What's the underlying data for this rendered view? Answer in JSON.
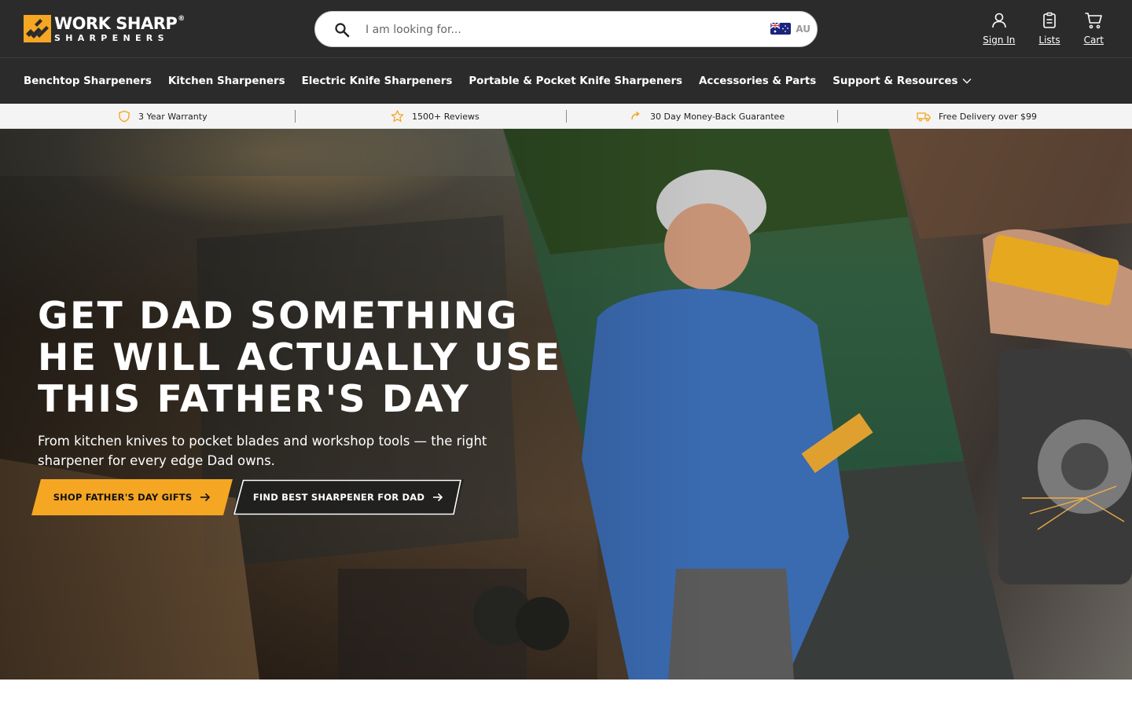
{
  "brand": {
    "name_line1": "WORK SHARP",
    "registered_mark": "®",
    "name_line2": "SHARPENERS",
    "accent_color": "#f5a623",
    "header_bg": "#2b2b2b"
  },
  "search": {
    "placeholder": "I am looking for...",
    "value": "",
    "region_code": "AU",
    "icon": "search-icon",
    "flag_icon": "australia-flag-icon"
  },
  "header_actions": [
    {
      "label": "Sign In",
      "icon": "user-icon"
    },
    {
      "label": "Lists",
      "icon": "clipboard-icon"
    },
    {
      "label": "Cart",
      "icon": "cart-icon"
    }
  ],
  "nav": {
    "items": [
      {
        "label": "Benchtop Sharpeners"
      },
      {
        "label": "Kitchen Sharpeners"
      },
      {
        "label": "Electric Knife Sharpeners"
      },
      {
        "label": "Portable & Pocket Knife Sharpeners"
      },
      {
        "label": "Accessories & Parts"
      },
      {
        "label": "Support & Resources",
        "icon": "chevron-down-icon"
      }
    ]
  },
  "usp_bar": {
    "items": [
      {
        "label": "3 Year Warranty",
        "icon": "shield-icon"
      },
      {
        "label": "1500+ Reviews",
        "icon": "star-icon"
      },
      {
        "label": "30 Day Money-Back Guarantee",
        "icon": "return-arrow-icon"
      },
      {
        "label": "Free Delivery over $99",
        "icon": "delivery-truck-icon"
      }
    ]
  },
  "hero": {
    "title_lines": [
      "GET DAD SOMETHING",
      "HE WILL ACTUALLY USE",
      "THIS FATHER'S DAY"
    ],
    "subtitle": "From kitchen knives to pocket blades and workshop tools — the right sharpener for every edge Dad owns.",
    "primary_cta": "SHOP FATHER'S DAY GIFTS",
    "secondary_cta": "FIND BEST SHARPENER FOR DAD"
  }
}
